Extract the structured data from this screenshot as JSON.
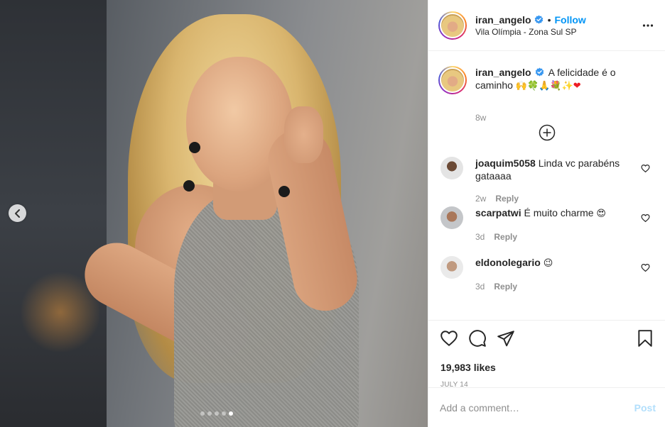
{
  "post": {
    "username": "iran_angelo",
    "verified": true,
    "separator": "•",
    "follow_label": "Follow",
    "location": "Vila Olímpia - Zona Sul SP",
    "more_icon": "more-horizontal-icon"
  },
  "photo": {
    "carousel_total": 5,
    "carousel_active": 5,
    "prev_icon": "chevron-left-icon"
  },
  "caption": {
    "username": "iran_angelo",
    "text": "A felicidade é o caminho",
    "emojis": "🙌🍀🙏💐✨",
    "heart": "❤",
    "time": "8w"
  },
  "comments": [
    {
      "username": "joaquim5058",
      "text": "Linda vc parabéns gataaaa",
      "time": "2w",
      "reply_label": "Reply"
    },
    {
      "username": "scarpatwi",
      "text": "É muito charme",
      "emoji": "😍",
      "time": "3d",
      "reply_label": "Reply"
    },
    {
      "username": "eldonolegario",
      "text": "",
      "emoji": "😉",
      "time": "3d",
      "reply_label": "Reply"
    }
  ],
  "actions": {
    "likes": "19,983 likes",
    "date": "JULY 14"
  },
  "add_comment": {
    "placeholder": "Add a comment…",
    "post_label": "Post"
  },
  "colors": {
    "link_blue": "#0095f6",
    "post_disabled": "#b2dffc",
    "muted": "#8e8e8e",
    "border": "#efefef"
  }
}
